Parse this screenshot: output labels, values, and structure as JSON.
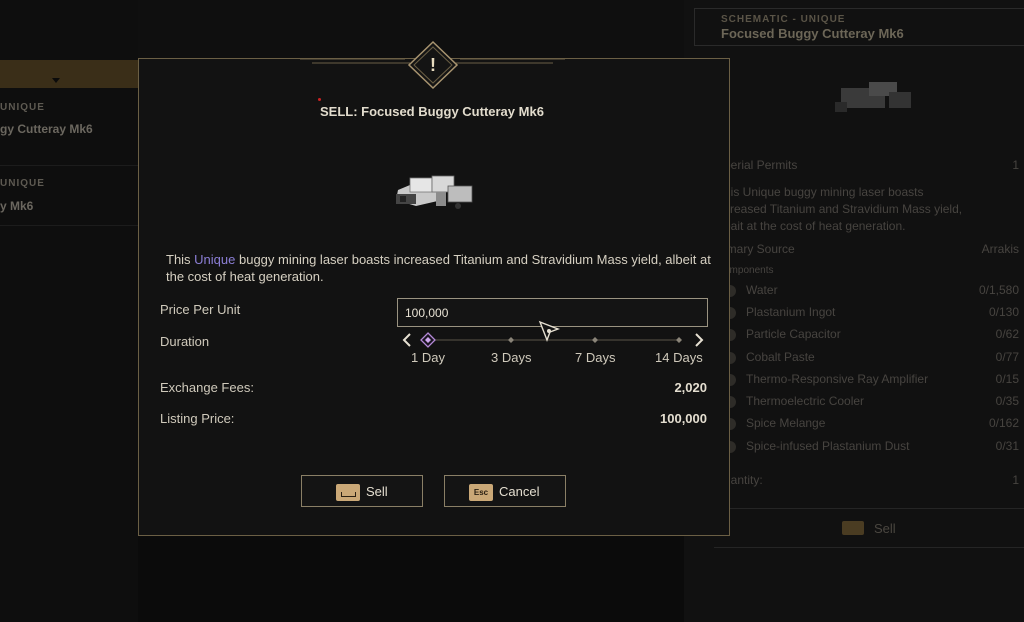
{
  "background": {
    "left_list": [
      {
        "tag": "UNIQUE",
        "name": "gy Cutteray Mk6"
      },
      {
        "tag": "UNIQUE",
        "name": "y Mk6"
      }
    ],
    "right_panel": {
      "tag": "SCHEMATIC - UNIQUE",
      "name": "Focused Buggy Cutteray Mk6",
      "permits_label": "perial Permits",
      "permits_value": "1",
      "desc_line1": "his Unique buggy mining laser boasts",
      "desc_line2": "creased Titanium and Stravidium Mass yield,",
      "desc_line3": "bait at the cost of heat generation.",
      "source_label": "imary Source",
      "source_value": "Arrakis",
      "components_label": "omponents",
      "components": [
        {
          "name": "Water",
          "value": "0/1,580"
        },
        {
          "name": "Plastanium Ingot",
          "value": "0/130"
        },
        {
          "name": "Particle Capacitor",
          "value": "0/62"
        },
        {
          "name": "Cobalt Paste",
          "value": "0/77"
        },
        {
          "name": "Thermo-Responsive Ray Amplifier",
          "value": "0/15"
        },
        {
          "name": "Thermoelectric Cooler",
          "value": "0/35"
        },
        {
          "name": "Spice Melange",
          "value": "0/162"
        },
        {
          "name": "Spice-infused Plastanium Dust",
          "value": "0/31"
        }
      ],
      "quantity_label": "uantity:",
      "quantity_value": "1",
      "sell_label": "Sell"
    }
  },
  "modal": {
    "warning_symbol": "!",
    "title": "SELL: Focused Buggy Cutteray Mk6",
    "description_prefix": "This ",
    "description_unique": "Unique",
    "description_rest": " buggy mining laser boasts increased Titanium and Stravidium Mass yield, albeit at the cost of heat generation.",
    "price_per_unit_label": "Price Per Unit",
    "price_per_unit_value": "100,000",
    "duration_label": "Duration",
    "duration_options": [
      "1 Day",
      "3 Days",
      "7 Days",
      "14 Days"
    ],
    "duration_selected": "1 Day",
    "exchange_fees_label": "Exchange Fees:",
    "exchange_fees_value": "2,020",
    "listing_price_label": "Listing Price:",
    "listing_price_value": "100,000",
    "sell_button": "Sell",
    "cancel_button": "Cancel",
    "cancel_key": "Esc"
  },
  "colors": {
    "accent_gold": "#caa877",
    "unique_purple": "#8c7fd6",
    "border": "#6b5f45"
  }
}
